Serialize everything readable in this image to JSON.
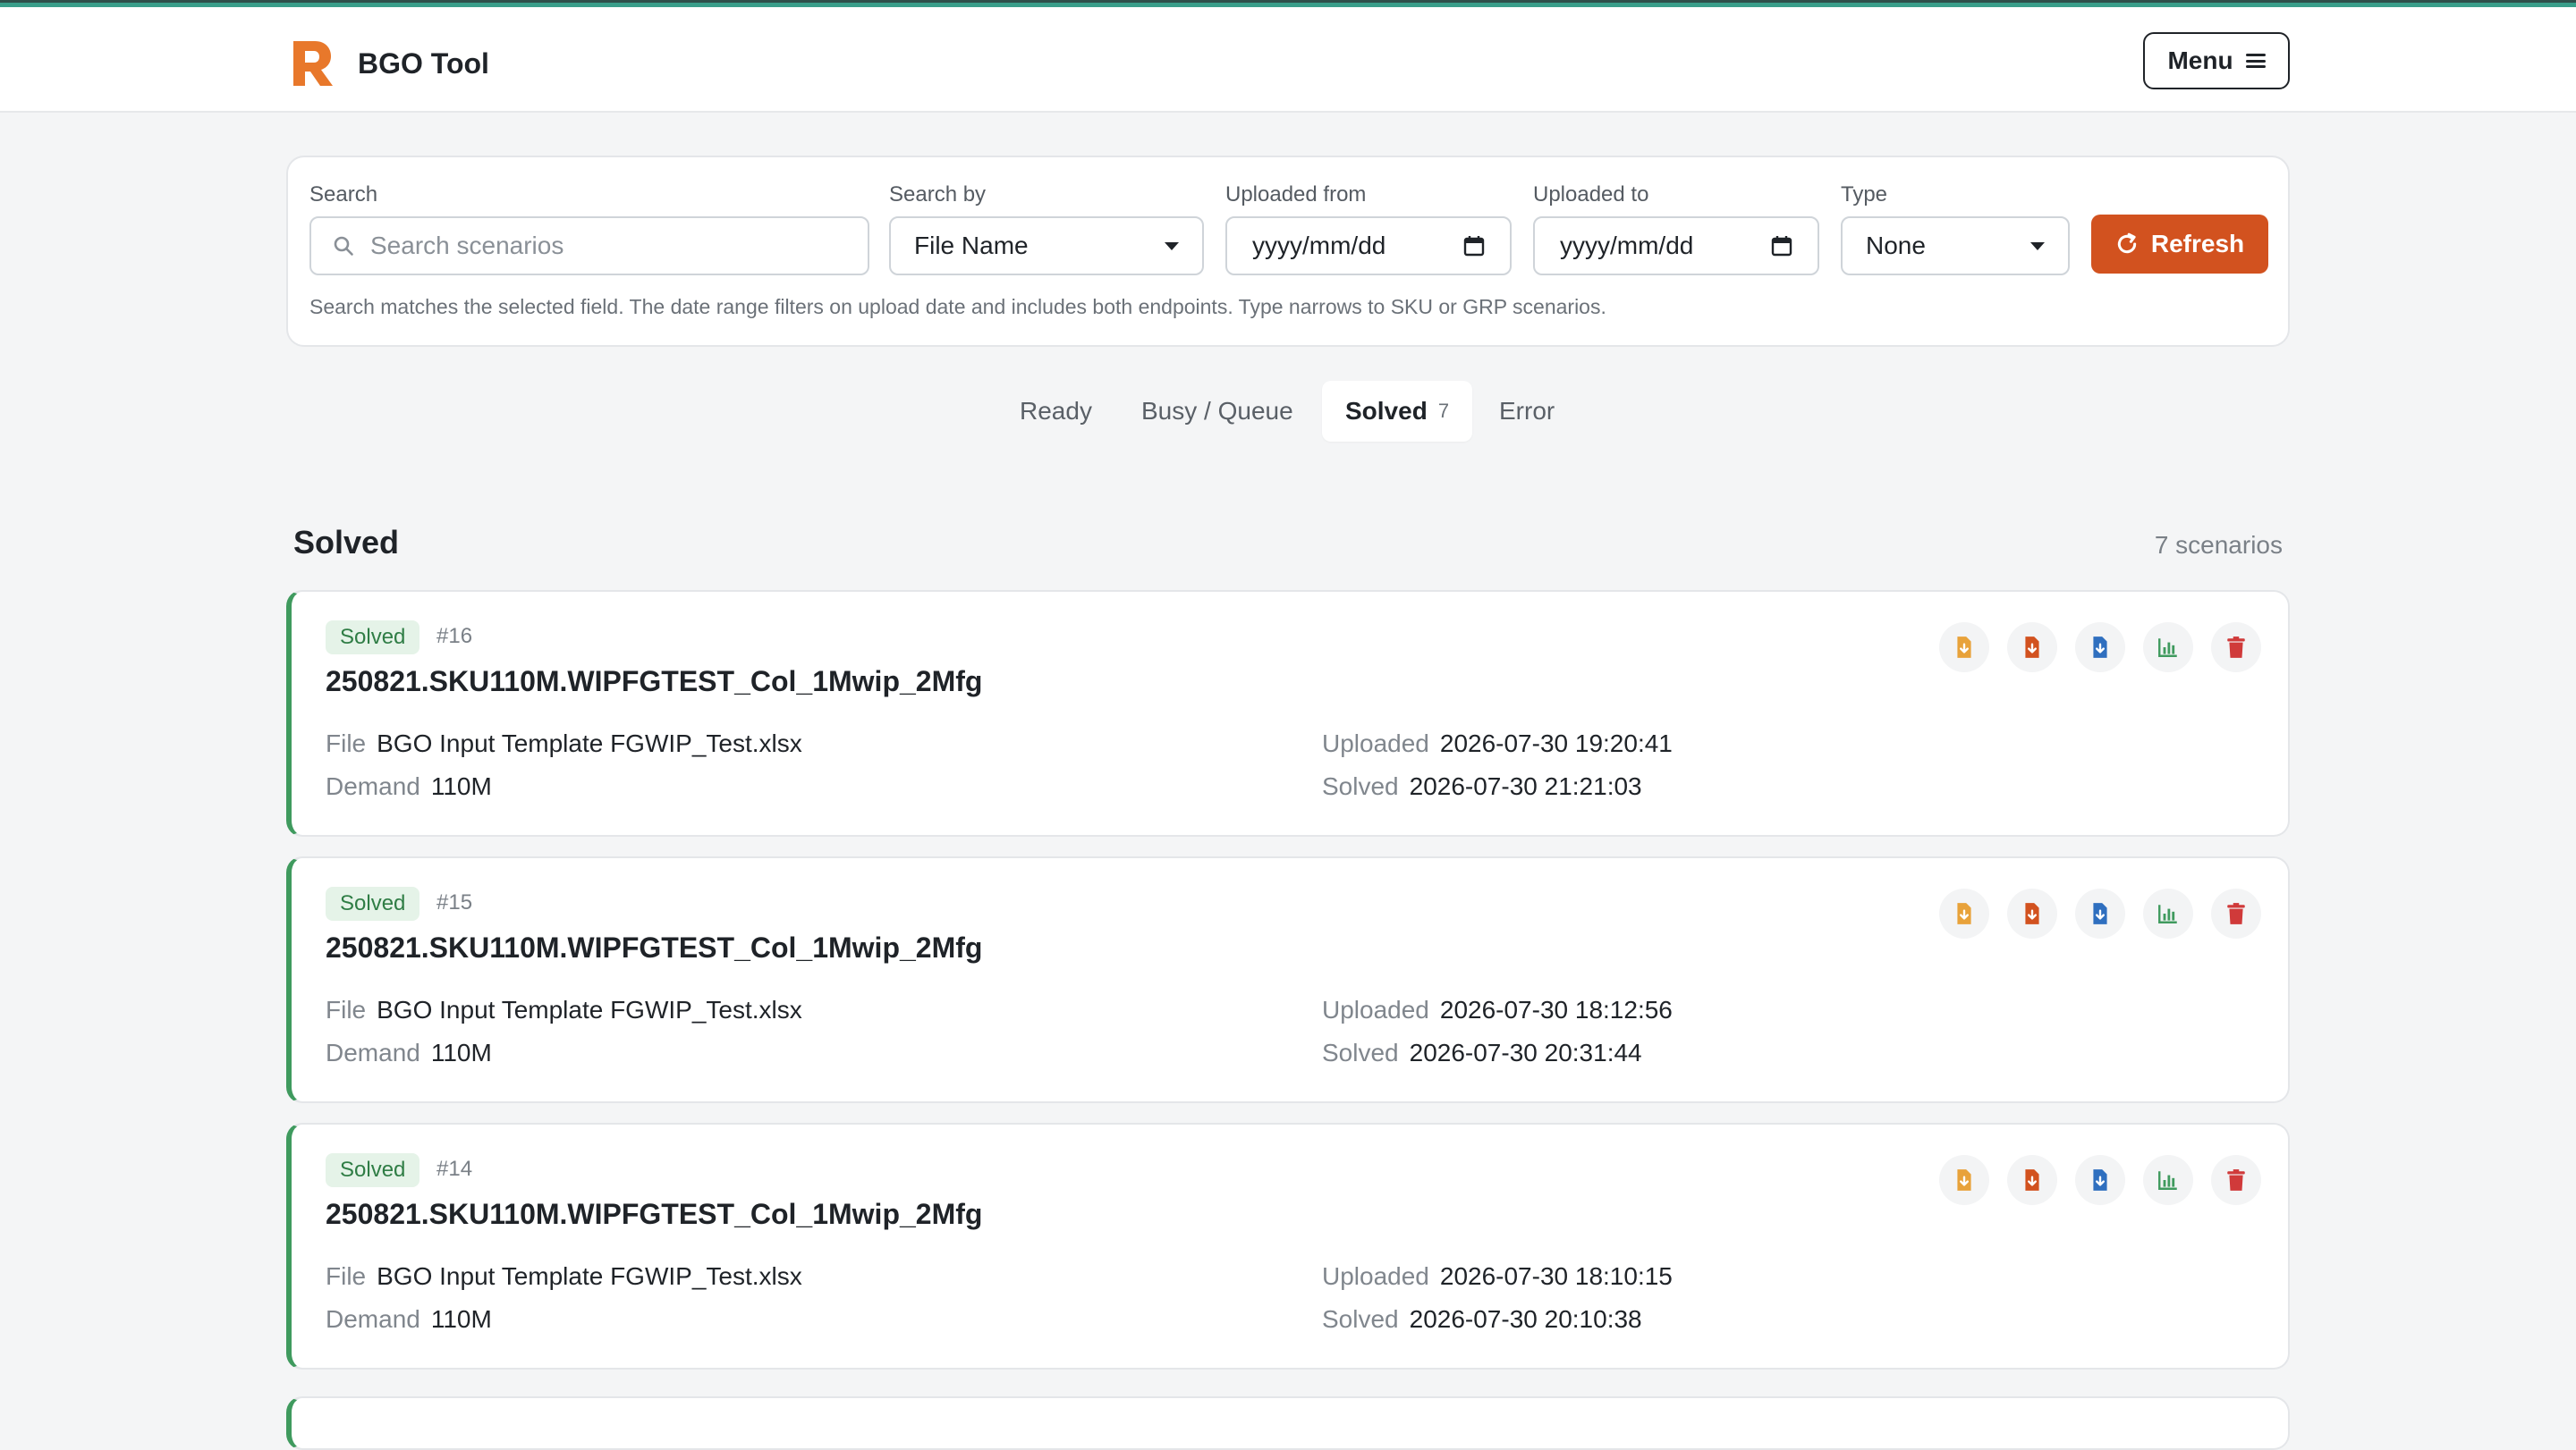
{
  "app": {
    "name": "BGO Tool",
    "menu_label": "Menu",
    "brand_color": "#e8782b"
  },
  "filters": {
    "search_label": "Search",
    "search_placeholder": "Search scenarios",
    "search_by_label": "Search by",
    "search_by_value": "File Name",
    "uploaded_from_label": "Uploaded from",
    "uploaded_from_value": "yyyy/mm/dd",
    "uploaded_to_label": "Uploaded to",
    "uploaded_to_value": "yyyy/mm/dd",
    "type_label": "Type",
    "type_value": "None",
    "refresh_label": "Refresh",
    "helper_text": "Search matches the selected field. The date range filters on upload date and includes both endpoints. Type narrows to SKU or GRP scenarios."
  },
  "tabs": [
    {
      "label": "Ready",
      "count": ""
    },
    {
      "label": "Busy / Queue",
      "count": ""
    },
    {
      "label": "Solved",
      "count": "7"
    },
    {
      "label": "Error",
      "count": ""
    }
  ],
  "section": {
    "title": "Solved",
    "count_text": "7 scenarios"
  },
  "labels": {
    "file": "File",
    "demand": "Demand",
    "uploaded": "Uploaded",
    "solved": "Solved"
  },
  "scenarios": [
    {
      "status": "Solved",
      "id": "#16",
      "name": "250821.SKU110M.WIPFGTEST_Col_1Mwip_2Mfg",
      "file": "BGO Input Template FGWIP_Test.xlsx",
      "demand": "110M",
      "uploaded": "2026-07-30 19:20:41",
      "solved": "2026-07-30 21:21:03"
    },
    {
      "status": "Solved",
      "id": "#15",
      "name": "250821.SKU110M.WIPFGTEST_Col_1Mwip_2Mfg",
      "file": "BGO Input Template FGWIP_Test.xlsx",
      "demand": "110M",
      "uploaded": "2026-07-30 18:12:56",
      "solved": "2026-07-30 20:31:44"
    },
    {
      "status": "Solved",
      "id": "#14",
      "name": "250821.SKU110M.WIPFGTEST_Col_1Mwip_2Mfg",
      "file": "BGO Input Template FGWIP_Test.xlsx",
      "demand": "110M",
      "uploaded": "2026-07-30 18:10:15",
      "solved": "2026-07-30 20:10:38"
    }
  ],
  "action_icons": [
    {
      "name": "download-input-icon",
      "color": "#e8a23a"
    },
    {
      "name": "download-output-icon",
      "color": "#d2521f"
    },
    {
      "name": "download-report-icon",
      "color": "#2f6fbf"
    },
    {
      "name": "chart-icon",
      "color": "#3f9a5e"
    },
    {
      "name": "delete-icon",
      "color": "#d03a3a"
    }
  ]
}
